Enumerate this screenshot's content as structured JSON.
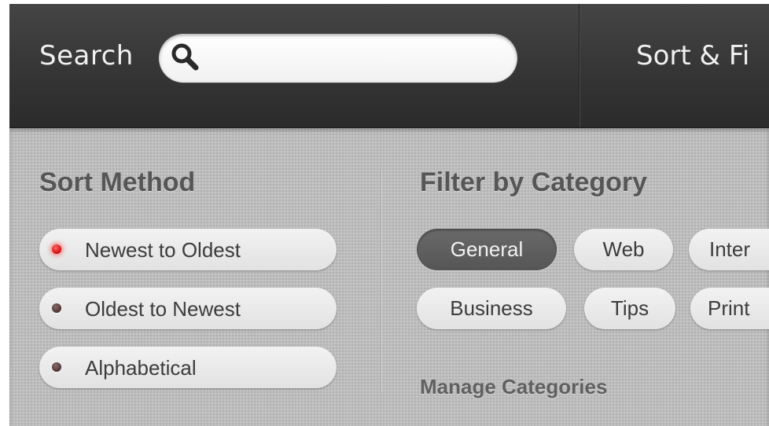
{
  "header": {
    "search_label": "Search",
    "search_value": "",
    "search_placeholder": "",
    "search_icon": "magnifying-glass-icon",
    "sort_filter_title": "Sort & Fi"
  },
  "sort": {
    "heading": "Sort Method",
    "selected": "Newest to Oldest",
    "options": [
      {
        "label": "Newest to Oldest",
        "active": true
      },
      {
        "label": "Oldest to Newest",
        "active": false
      },
      {
        "label": "Alphabetical",
        "active": false
      }
    ]
  },
  "filter": {
    "heading": "Filter by Category",
    "categories": [
      {
        "label": "General",
        "selected": true
      },
      {
        "label": "Web",
        "selected": false
      },
      {
        "label": "Inter",
        "selected": false
      },
      {
        "label": "Business",
        "selected": false
      },
      {
        "label": "Tips",
        "selected": false
      },
      {
        "label": "Print",
        "selected": false
      }
    ],
    "manage_label": "Manage Categories"
  },
  "colors": {
    "header_bg": "#383838",
    "panel_bg": "#bcbcbc",
    "selected_chip": "#5f5f5f",
    "active_indicator": "#d40d0d",
    "inactive_indicator": "#4a3232"
  }
}
